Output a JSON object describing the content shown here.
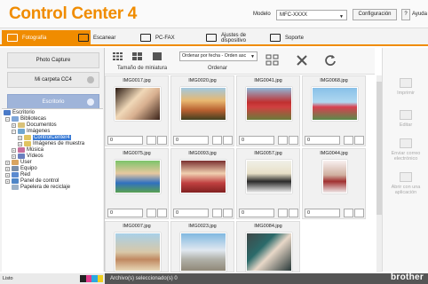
{
  "app": {
    "title": "Control Center 4",
    "model_label": "Modelo",
    "model_value": "MFC-XXXX",
    "config_label": "Configuración",
    "help_q": "?",
    "help_label": "Ayuda"
  },
  "tabs": [
    {
      "label": "Fotografía"
    },
    {
      "label": "Escanear"
    },
    {
      "label": "PC-FAX"
    },
    {
      "label": "Ajustes de\ndispositivo"
    },
    {
      "label": "Soporte"
    }
  ],
  "left": {
    "photo_capture": "Photo Capture",
    "my_folder": "Mi carpeta CC4",
    "desktop": "Escritorio"
  },
  "tree": [
    "Escritorio",
    "Bibliotecas",
    "Documentos",
    "Imágenes",
    "ControlCenter4",
    "Imágenes de muestra",
    "Música",
    "Vídeos",
    "User",
    "Equipo",
    "Red",
    "Panel de control",
    "Papelera de reciclaje"
  ],
  "toolbar": {
    "thumb_size": "Tamaño de miniatura",
    "sort_value": "Ordenar por fecha - Orden asc",
    "sort_label": "Ordenar"
  },
  "images": [
    {
      "name": "IMG0017.jpg",
      "count": "0"
    },
    {
      "name": "IMG0020.jpg",
      "count": "0"
    },
    {
      "name": "IMG0041.jpg",
      "count": "0"
    },
    {
      "name": "IMG0068.jpg",
      "count": "0"
    },
    {
      "name": "IMG0075.jpg",
      "count": "0"
    },
    {
      "name": "IMG0093.jpg",
      "count": "0"
    },
    {
      "name": "IMG0057.jpg",
      "count": "0"
    },
    {
      "name": "IMG0044.jpg",
      "count": "0"
    },
    {
      "name": "IMG0007.jpg",
      "count": ""
    },
    {
      "name": "IMG0023.jpg",
      "count": ""
    },
    {
      "name": "IMG0084.jpg",
      "count": ""
    }
  ],
  "actions": {
    "print": "Imprimir",
    "edit": "Editar",
    "email": "Enviar correo electrónico",
    "open_app": "Abrir con una aplicación"
  },
  "status": {
    "ready": "Listo",
    "selected": "Archivo(s) seleccionado(s) 0",
    "brand": "brother"
  },
  "colors": {
    "accent": "#f08c00",
    "selected_blue": "#9fb4d9"
  }
}
